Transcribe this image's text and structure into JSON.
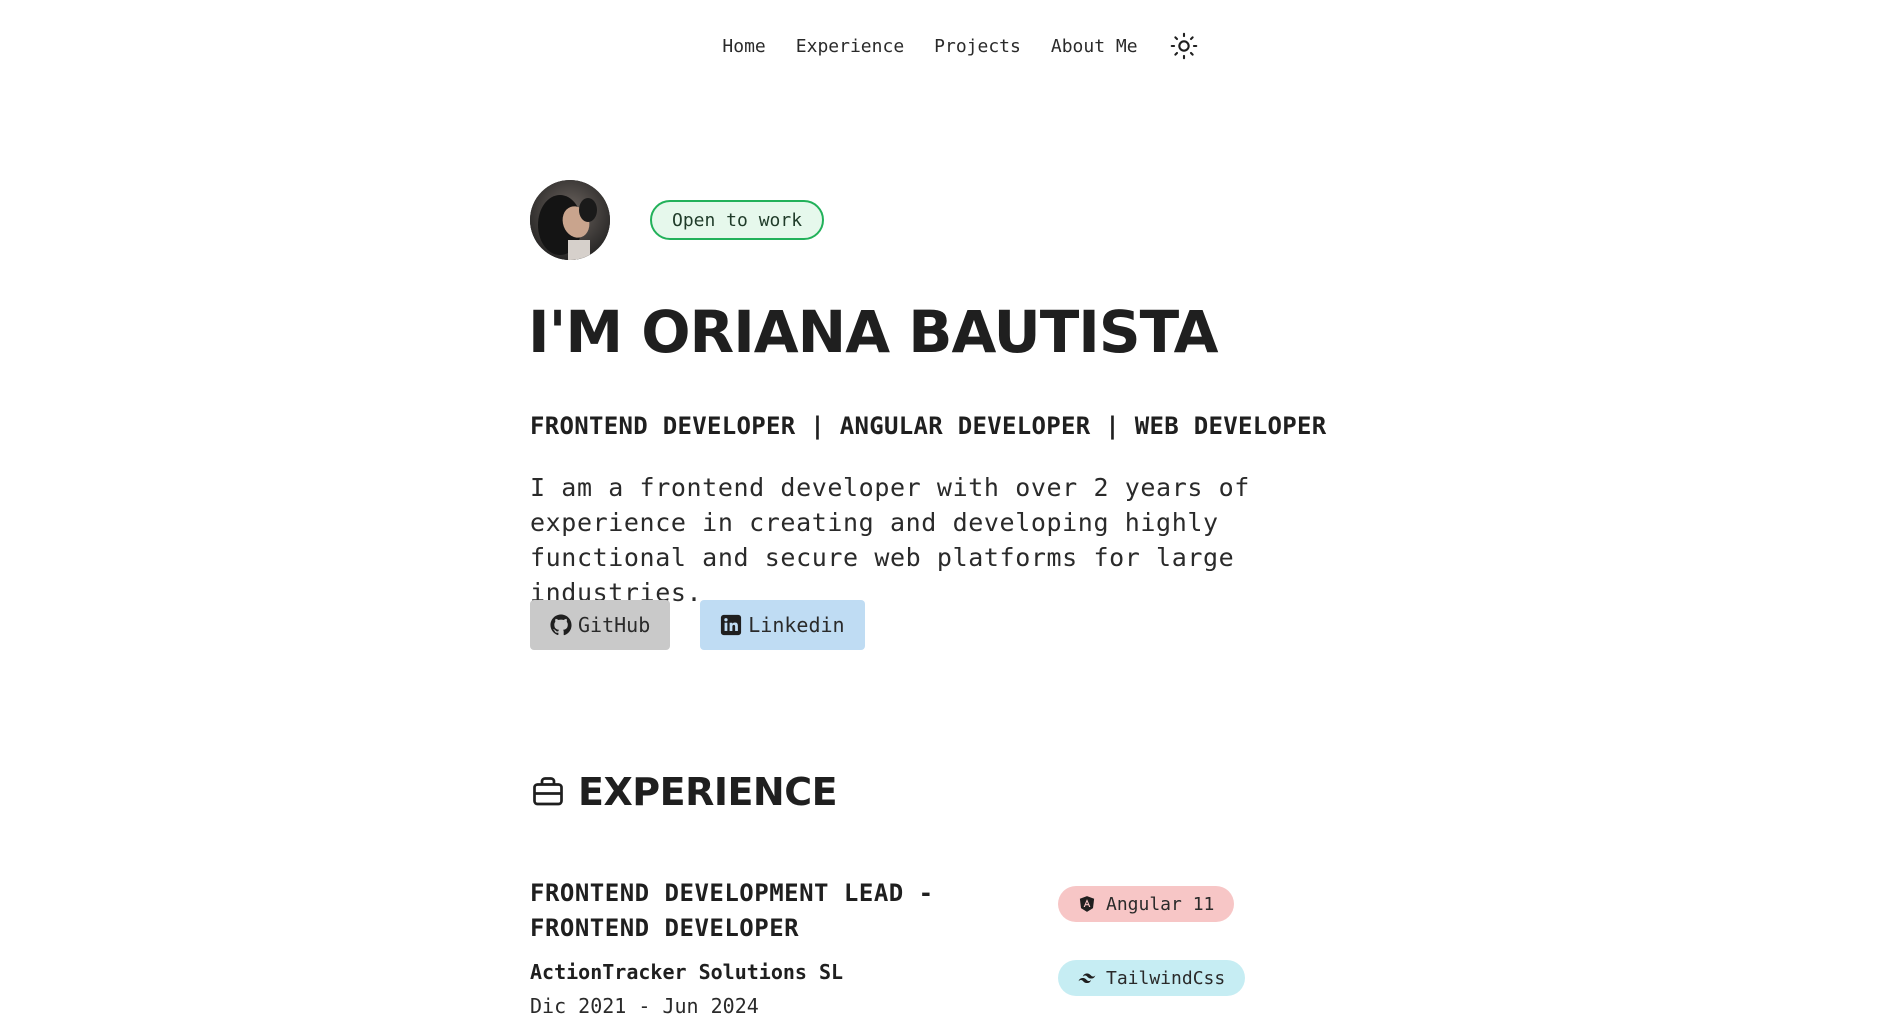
{
  "nav": {
    "items": [
      {
        "label": "Home"
      },
      {
        "label": "Experience"
      },
      {
        "label": "Projects"
      },
      {
        "label": "About Me"
      }
    ],
    "theme_icon": "sun-icon"
  },
  "hero": {
    "badge": "Open to work",
    "title": "I'M ORIANA BAUTISTA",
    "roles": "FRONTEND DEVELOPER | ANGULAR DEVELOPER | WEB DEVELOPER",
    "description": "I am a frontend developer with over 2 years of experience in creating and developing highly functional and secure web platforms for large industries.",
    "social": [
      {
        "label": "GitHub",
        "icon": "github-icon"
      },
      {
        "label": "Linkedin",
        "icon": "linkedin-icon"
      }
    ]
  },
  "experience": {
    "heading": "EXPERIENCE",
    "icon": "briefcase-icon",
    "jobs": [
      {
        "title": "FRONTEND DEVELOPMENT LEAD - FRONTEND DEVELOPER",
        "company": "ActionTracker Solutions SL",
        "dates": "Dic 2021 - Jun 2024",
        "tags": [
          {
            "label": "Angular 11",
            "icon": "angular-icon"
          },
          {
            "label": "TailwindCss",
            "icon": "tailwind-icon"
          }
        ]
      }
    ]
  },
  "colors": {
    "badge_border": "#22b15a",
    "badge_bg": "#e6f8ec",
    "github_bg": "#c9c9c9",
    "linkedin_bg": "#bfdcf3",
    "angular_tag_bg": "#f7c6c6",
    "tailwind_tag_bg": "#c6edf3"
  }
}
